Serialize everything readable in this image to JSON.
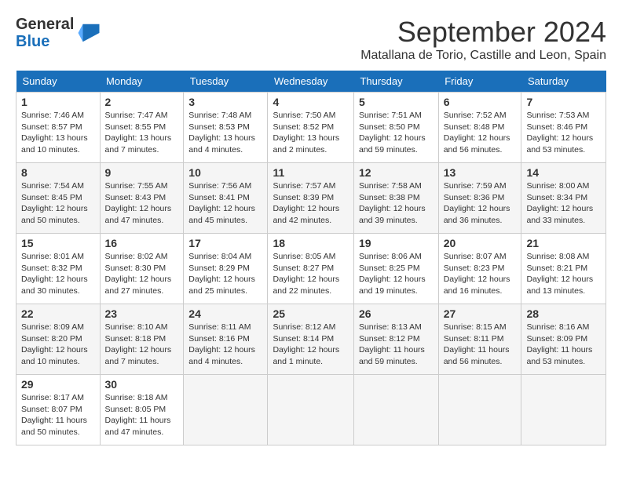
{
  "logo": {
    "general": "General",
    "blue": "Blue"
  },
  "title": "September 2024",
  "location": "Matallana de Torio, Castille and Leon, Spain",
  "headers": [
    "Sunday",
    "Monday",
    "Tuesday",
    "Wednesday",
    "Thursday",
    "Friday",
    "Saturday"
  ],
  "weeks": [
    [
      {
        "day": "1",
        "info": "Sunrise: 7:46 AM\nSunset: 8:57 PM\nDaylight: 13 hours and 10 minutes."
      },
      {
        "day": "2",
        "info": "Sunrise: 7:47 AM\nSunset: 8:55 PM\nDaylight: 13 hours and 7 minutes."
      },
      {
        "day": "3",
        "info": "Sunrise: 7:48 AM\nSunset: 8:53 PM\nDaylight: 13 hours and 4 minutes."
      },
      {
        "day": "4",
        "info": "Sunrise: 7:50 AM\nSunset: 8:52 PM\nDaylight: 13 hours and 2 minutes."
      },
      {
        "day": "5",
        "info": "Sunrise: 7:51 AM\nSunset: 8:50 PM\nDaylight: 12 hours and 59 minutes."
      },
      {
        "day": "6",
        "info": "Sunrise: 7:52 AM\nSunset: 8:48 PM\nDaylight: 12 hours and 56 minutes."
      },
      {
        "day": "7",
        "info": "Sunrise: 7:53 AM\nSunset: 8:46 PM\nDaylight: 12 hours and 53 minutes."
      }
    ],
    [
      {
        "day": "8",
        "info": "Sunrise: 7:54 AM\nSunset: 8:45 PM\nDaylight: 12 hours and 50 minutes."
      },
      {
        "day": "9",
        "info": "Sunrise: 7:55 AM\nSunset: 8:43 PM\nDaylight: 12 hours and 47 minutes."
      },
      {
        "day": "10",
        "info": "Sunrise: 7:56 AM\nSunset: 8:41 PM\nDaylight: 12 hours and 45 minutes."
      },
      {
        "day": "11",
        "info": "Sunrise: 7:57 AM\nSunset: 8:39 PM\nDaylight: 12 hours and 42 minutes."
      },
      {
        "day": "12",
        "info": "Sunrise: 7:58 AM\nSunset: 8:38 PM\nDaylight: 12 hours and 39 minutes."
      },
      {
        "day": "13",
        "info": "Sunrise: 7:59 AM\nSunset: 8:36 PM\nDaylight: 12 hours and 36 minutes."
      },
      {
        "day": "14",
        "info": "Sunrise: 8:00 AM\nSunset: 8:34 PM\nDaylight: 12 hours and 33 minutes."
      }
    ],
    [
      {
        "day": "15",
        "info": "Sunrise: 8:01 AM\nSunset: 8:32 PM\nDaylight: 12 hours and 30 minutes."
      },
      {
        "day": "16",
        "info": "Sunrise: 8:02 AM\nSunset: 8:30 PM\nDaylight: 12 hours and 27 minutes."
      },
      {
        "day": "17",
        "info": "Sunrise: 8:04 AM\nSunset: 8:29 PM\nDaylight: 12 hours and 25 minutes."
      },
      {
        "day": "18",
        "info": "Sunrise: 8:05 AM\nSunset: 8:27 PM\nDaylight: 12 hours and 22 minutes."
      },
      {
        "day": "19",
        "info": "Sunrise: 8:06 AM\nSunset: 8:25 PM\nDaylight: 12 hours and 19 minutes."
      },
      {
        "day": "20",
        "info": "Sunrise: 8:07 AM\nSunset: 8:23 PM\nDaylight: 12 hours and 16 minutes."
      },
      {
        "day": "21",
        "info": "Sunrise: 8:08 AM\nSunset: 8:21 PM\nDaylight: 12 hours and 13 minutes."
      }
    ],
    [
      {
        "day": "22",
        "info": "Sunrise: 8:09 AM\nSunset: 8:20 PM\nDaylight: 12 hours and 10 minutes."
      },
      {
        "day": "23",
        "info": "Sunrise: 8:10 AM\nSunset: 8:18 PM\nDaylight: 12 hours and 7 minutes."
      },
      {
        "day": "24",
        "info": "Sunrise: 8:11 AM\nSunset: 8:16 PM\nDaylight: 12 hours and 4 minutes."
      },
      {
        "day": "25",
        "info": "Sunrise: 8:12 AM\nSunset: 8:14 PM\nDaylight: 12 hours and 1 minute."
      },
      {
        "day": "26",
        "info": "Sunrise: 8:13 AM\nSunset: 8:12 PM\nDaylight: 11 hours and 59 minutes."
      },
      {
        "day": "27",
        "info": "Sunrise: 8:15 AM\nSunset: 8:11 PM\nDaylight: 11 hours and 56 minutes."
      },
      {
        "day": "28",
        "info": "Sunrise: 8:16 AM\nSunset: 8:09 PM\nDaylight: 11 hours and 53 minutes."
      }
    ],
    [
      {
        "day": "29",
        "info": "Sunrise: 8:17 AM\nSunset: 8:07 PM\nDaylight: 11 hours and 50 minutes."
      },
      {
        "day": "30",
        "info": "Sunrise: 8:18 AM\nSunset: 8:05 PM\nDaylight: 11 hours and 47 minutes."
      },
      {
        "day": "",
        "info": ""
      },
      {
        "day": "",
        "info": ""
      },
      {
        "day": "",
        "info": ""
      },
      {
        "day": "",
        "info": ""
      },
      {
        "day": "",
        "info": ""
      }
    ]
  ]
}
